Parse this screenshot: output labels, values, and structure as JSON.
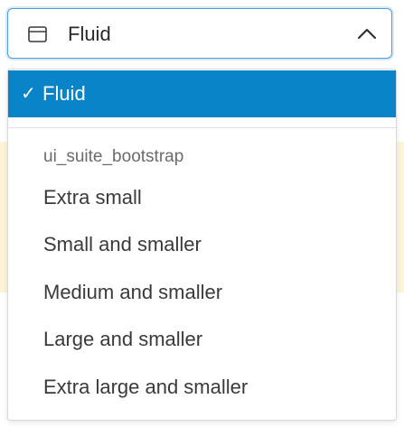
{
  "select": {
    "current_value": "Fluid",
    "icon": "window-icon",
    "expanded": true
  },
  "menu": {
    "selected_option": {
      "check": "✓",
      "label": "Fluid"
    },
    "group_label": "ui_suite_bootstrap",
    "options": [
      "Extra small",
      "Small and smaller",
      "Medium and smaller",
      "Large and smaller",
      "Extra large and smaller"
    ]
  },
  "colors": {
    "accent": "#0a84c9",
    "focus_border": "#4aa3d8",
    "warning_background": "#fdf4d8"
  }
}
